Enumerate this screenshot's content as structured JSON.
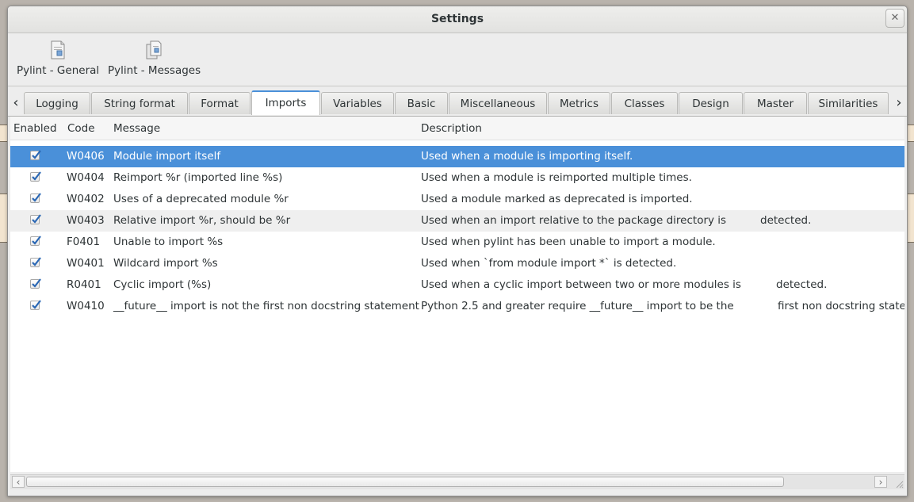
{
  "window": {
    "title": "Settings",
    "close_glyph": "✕"
  },
  "toolbar": {
    "items": [
      {
        "label": "Pylint - General",
        "icon": "document-icon"
      },
      {
        "label": "Pylint - Messages",
        "icon": "documents-icon"
      }
    ]
  },
  "tabs": {
    "items": [
      "Logging",
      "String format",
      "Format",
      "Imports",
      "Variables",
      "Basic",
      "Miscellaneous",
      "Metrics",
      "Classes",
      "Design",
      "Master",
      "Similarities"
    ],
    "active": "Imports"
  },
  "table": {
    "headers": {
      "enabled": "Enabled",
      "code": "Code",
      "message": "Message",
      "description": "Description"
    },
    "rows": [
      {
        "enabled": true,
        "code": "W0406",
        "message": "Module import itself",
        "description": "Used when a module is importing itself.",
        "description_tail": ""
      },
      {
        "enabled": true,
        "code": "W0404",
        "message": "Reimport %r (imported line %s)",
        "description": "Used when a module is reimported multiple times.",
        "description_tail": ""
      },
      {
        "enabled": true,
        "code": "W0402",
        "message": "Uses of a deprecated module %r",
        "description": "Used a module marked as deprecated is imported.",
        "description_tail": ""
      },
      {
        "enabled": true,
        "code": "W0403",
        "message": "Relative import %r, should be %r",
        "description": "Used when an import relative to the package directory is",
        "description_tail": "detected."
      },
      {
        "enabled": true,
        "code": "F0401",
        "message": "Unable to import %s",
        "description": "Used when pylint has been unable to import a module.",
        "description_tail": ""
      },
      {
        "enabled": true,
        "code": "W0401",
        "message": "Wildcard import %s",
        "description": "Used when `from module import *` is detected.",
        "description_tail": ""
      },
      {
        "enabled": true,
        "code": "R0401",
        "message": "Cyclic import (%s)",
        "description": "Used when a cyclic import between two or more modules is",
        "description_tail": "detected."
      },
      {
        "enabled": true,
        "code": "W0410",
        "message": "__future__ import is not the first non docstring statement",
        "description": "Python 2.5 and greater require __future__ import to be the",
        "description_tail": "first non docstring statement"
      }
    ],
    "selected_row": 0
  },
  "scrollbar": {
    "left_glyph": "‹",
    "right_glyph": "›"
  },
  "colors": {
    "selection": "#4a90d9",
    "accent": "#4a90d9"
  }
}
